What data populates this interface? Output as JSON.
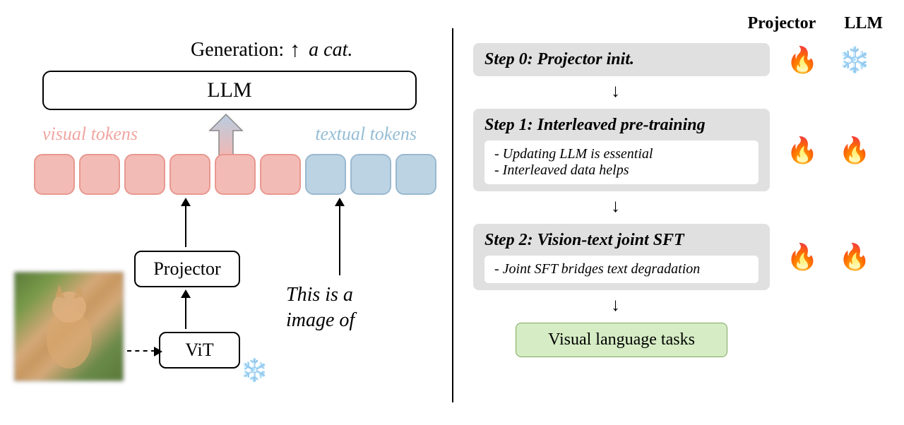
{
  "left": {
    "generation_label": "Generation:",
    "generation_output": "a cat.",
    "llm": "LLM",
    "visual_tokens_label": "visual tokens",
    "textual_tokens_label": "textual tokens",
    "projector": "Projector",
    "vit": "ViT",
    "caption_line1": "This is a",
    "caption_line2": "image of"
  },
  "right": {
    "header_projector": "Projector",
    "header_llm": "LLM",
    "steps": [
      {
        "title": "Step 0: Projector init.",
        "bullets": [],
        "projector_icon": "fire",
        "llm_icon": "snow"
      },
      {
        "title": "Step 1: Interleaved pre-training",
        "bullets": [
          "Updating LLM is essential",
          "Interleaved data helps"
        ],
        "projector_icon": "fire",
        "llm_icon": "fire"
      },
      {
        "title": "Step 2: Vision-text joint SFT",
        "bullets": [
          "Joint SFT bridges text degradation"
        ],
        "projector_icon": "fire",
        "llm_icon": "fire"
      }
    ],
    "final": "Visual language tasks"
  },
  "icons": {
    "fire": "🔥",
    "snow": "❄️"
  }
}
